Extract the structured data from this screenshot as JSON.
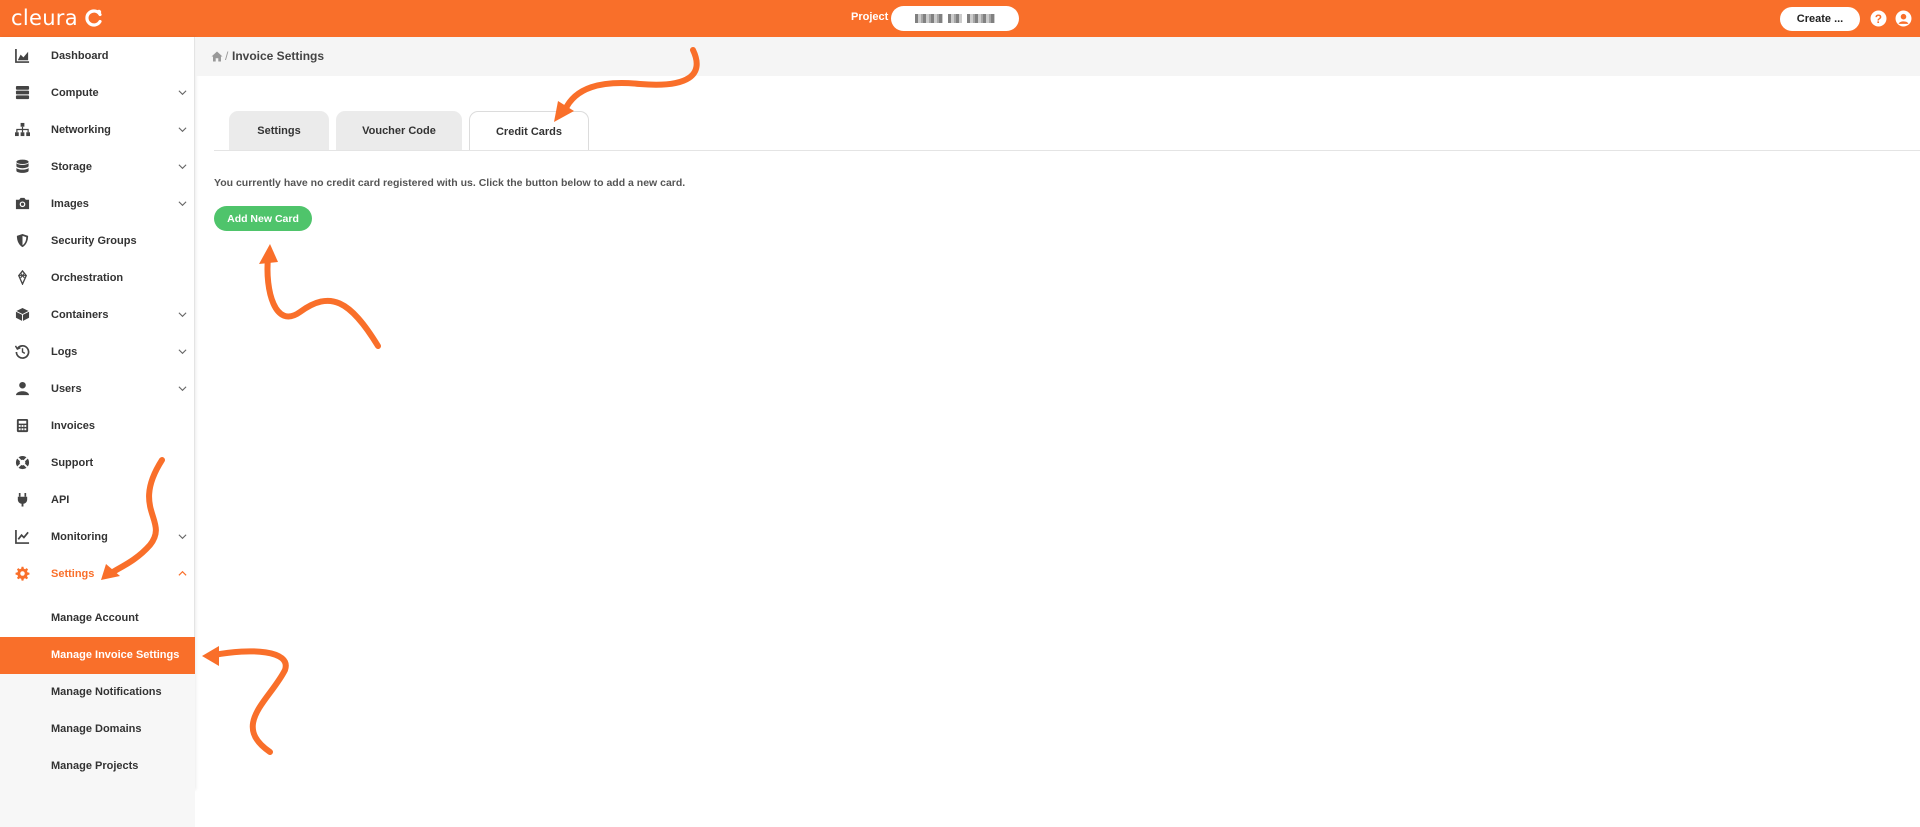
{
  "brand": {
    "name": "cleura",
    "color": "#f96f2a"
  },
  "header": {
    "project_label": "Project",
    "create_label": "Create ...",
    "help_icon": "question-circle-icon",
    "user_icon": "user-circle-icon"
  },
  "sidebar": {
    "items": [
      {
        "label": "Dashboard",
        "icon": "chart-area-icon",
        "expandable": false
      },
      {
        "label": "Compute",
        "icon": "server-icon",
        "expandable": true
      },
      {
        "label": "Networking",
        "icon": "sitemap-icon",
        "expandable": true
      },
      {
        "label": "Storage",
        "icon": "database-icon",
        "expandable": true
      },
      {
        "label": "Images",
        "icon": "camera-icon",
        "expandable": true
      },
      {
        "label": "Security Groups",
        "icon": "shield-icon",
        "expandable": false
      },
      {
        "label": "Orchestration",
        "icon": "layers-icon",
        "expandable": false
      },
      {
        "label": "Containers",
        "icon": "cube-icon",
        "expandable": true
      },
      {
        "label": "Logs",
        "icon": "history-icon",
        "expandable": true
      },
      {
        "label": "Users",
        "icon": "user-icon",
        "expandable": true
      },
      {
        "label": "Invoices",
        "icon": "calculator-icon",
        "expandable": false
      },
      {
        "label": "Support",
        "icon": "lifebuoy-icon",
        "expandable": false
      },
      {
        "label": "API",
        "icon": "plug-icon",
        "expandable": false
      },
      {
        "label": "Monitoring",
        "icon": "line-chart-icon",
        "expandable": true
      },
      {
        "label": "Settings",
        "icon": "gear-icon",
        "expandable": true,
        "expanded": true,
        "active": true
      }
    ],
    "settings_subitems": [
      {
        "label": "Manage Account"
      },
      {
        "label": "Manage Invoice Settings",
        "active": true
      },
      {
        "label": "Manage Notifications"
      },
      {
        "label": "Manage Domains"
      },
      {
        "label": "Manage Projects"
      }
    ]
  },
  "breadcrumb": {
    "separator": "/",
    "title": "Invoice Settings"
  },
  "tabs": [
    {
      "label": "Settings",
      "active": false
    },
    {
      "label": "Voucher Code",
      "active": false
    },
    {
      "label": "Credit Cards",
      "active": true
    }
  ],
  "main": {
    "info_text": "You currently have no credit card registered with us. Click the button below to add a new card.",
    "add_card_label": "Add New Card",
    "add_card_color": "#4fc46b"
  },
  "annotations": {
    "arrow_color": "#f96f2a"
  }
}
